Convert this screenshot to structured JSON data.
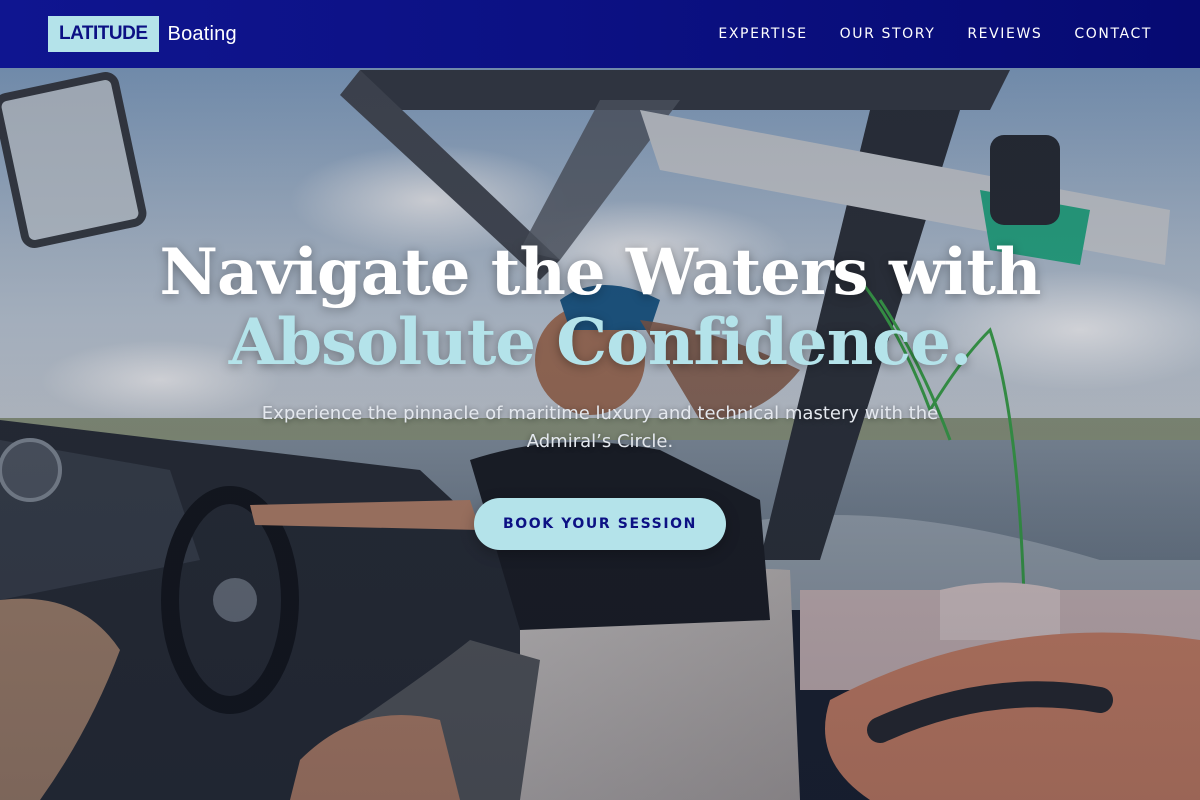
{
  "nav": {
    "logo_box": "LATITUDE",
    "logo_text": "Boating",
    "links": [
      "EXPERTISE",
      "OUR STORY",
      "REVIEWS",
      "CONTACT"
    ]
  },
  "hero": {
    "headline_line1": "Navigate the Waters with",
    "headline_line2": "Absolute Confidence.",
    "subtext": "Experience the pinnacle of maritime luxury and technical mastery with the Admiral’s Circle.",
    "cta_label": "BOOK YOUR SESSION",
    "image_subject": "boat-driver-photo"
  },
  "colors": {
    "nav_background": "#0c1184",
    "accent": "#b4e3ea",
    "headline_white": "#ffffff",
    "cta_text": "#0c1184"
  }
}
